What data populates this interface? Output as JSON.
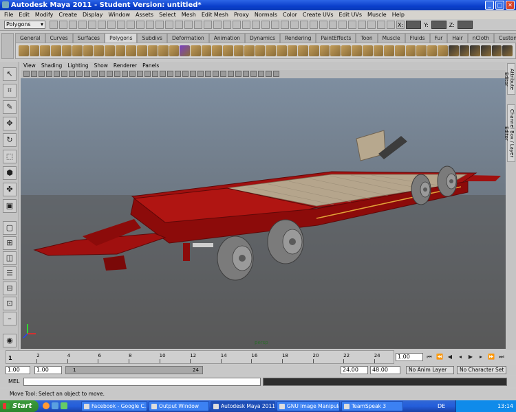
{
  "window": {
    "title": "Autodesk Maya 2011 - Student Version: untitled*"
  },
  "menubar": [
    "File",
    "Edit",
    "Modify",
    "Create",
    "Display",
    "Window",
    "Assets",
    "Select",
    "Mesh",
    "Edit Mesh",
    "Proxy",
    "Normals",
    "Color",
    "Create UVs",
    "Edit UVs",
    "Muscle",
    "Help"
  ],
  "status_line": {
    "mode": "Polygons",
    "x_label": "X:",
    "y_label": "Y:",
    "z_label": "Z:"
  },
  "shelf_tabs": [
    "General",
    "Curves",
    "Surfaces",
    "Polygons",
    "Subdivs",
    "Deformation",
    "Animation",
    "Dynamics",
    "Rendering",
    "PaintEffects",
    "Toon",
    "Muscle",
    "Fluids",
    "Fur",
    "Hair",
    "nCloth",
    "Custom"
  ],
  "active_shelf": "Polygons",
  "panel_menu": [
    "View",
    "Shading",
    "Lighting",
    "Show",
    "Renderer",
    "Panels"
  ],
  "viewport": {
    "label": "persp"
  },
  "side_tabs": [
    "Attribute Editor",
    "Channel Box / Layer Editor"
  ],
  "time_slider": {
    "ticks": [
      "1",
      "2",
      "4",
      "6",
      "8",
      "10",
      "12",
      "14",
      "16",
      "18",
      "20",
      "22",
      "24"
    ],
    "current_frame": "1",
    "current_field": "1.00"
  },
  "range": {
    "start": "1.00",
    "playback_start": "1.00",
    "slider_start": "1",
    "slider_end": "24",
    "playback_end": "24.00",
    "end": "48.00",
    "anim_layer": "No Anim Layer",
    "character_set": "No Character Set"
  },
  "mel": {
    "label": "MEL"
  },
  "help_line": "Move Tool: Select an object to move.",
  "taskbar": {
    "start": "Start",
    "tasks": [
      "Facebook - Google C...",
      "Output Window",
      "Autodesk Maya 2011 ...",
      "GNU Image Manipulat...",
      "TeamSpeak 3"
    ],
    "active_task": 2,
    "lang": "DE",
    "clock": "13:14"
  },
  "colors": {
    "trailer_red": "#a0100f",
    "deck_wood": "#b5a58c",
    "tire_gray": "#7c7c7c",
    "viewport_top": "#7e8ea0",
    "viewport_bottom": "#5a5a5a"
  }
}
